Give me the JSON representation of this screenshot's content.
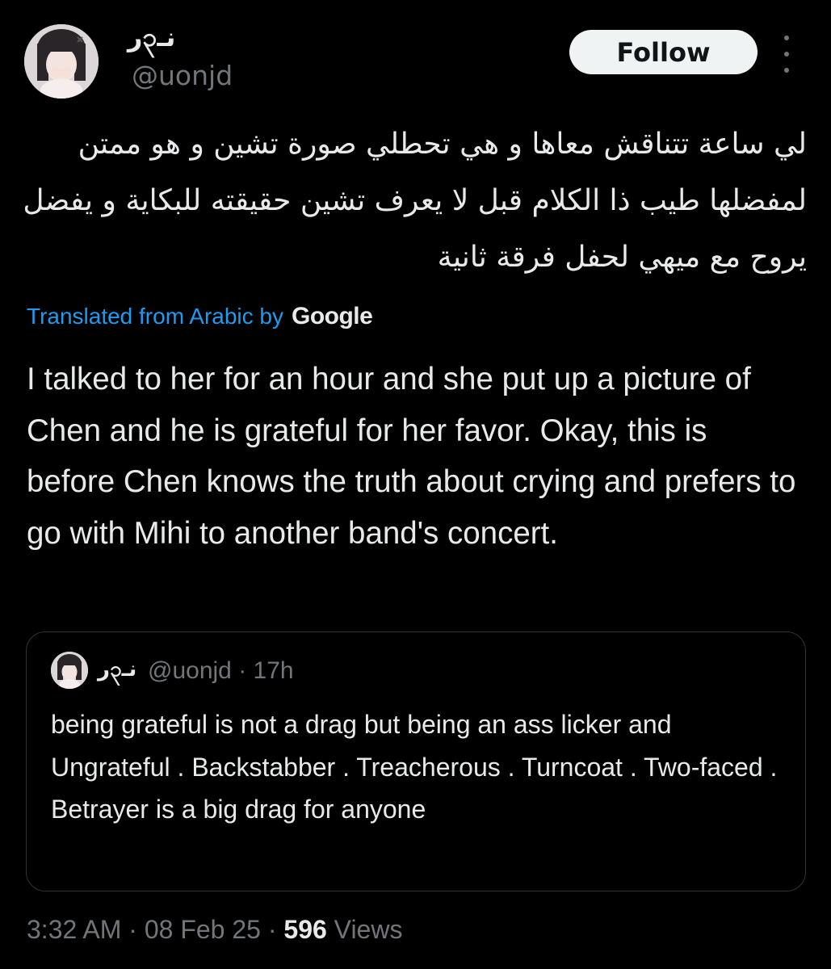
{
  "author": {
    "display_name": "نـ၃ر",
    "handle": "@uonjd"
  },
  "follow_label": "Follow",
  "tweet": {
    "arabic_text": "لي ساعة تتناقش معاها و هي تحطلي صورة تشين و هو ممتن لمفضلها طيب ذا الكلام قبل لا يعرف تشين حقيقته للبكاية و يفضل يروح مع ميهي لحفل فرقة ثانية",
    "translated_label": "Translated from Arabic by",
    "translator": "Google",
    "translated_text": "I talked to her for an hour and she put up a picture of Chen and he is grateful for her favor. Okay, this is before Chen knows the truth about crying and prefers to go with Mihi to another band's concert."
  },
  "quote": {
    "display_name": "نـ၃ر",
    "handle": "@uonjd",
    "separator": "·",
    "time_ago": "17h",
    "text": "being grateful is not a drag but being an ass licker and Ungrateful . Backstabber . Treacherous . Turncoat . Two-faced . Betrayer is a big drag for anyone"
  },
  "footer": {
    "time": "3:32 AM",
    "separator": "·",
    "date": "08 Feb 25",
    "views_count": "596",
    "views_label": "Views"
  },
  "colors": {
    "background": "#000000",
    "text_primary": "#e7e9ea",
    "text_secondary": "#71767b",
    "accent": "#1d9bf0",
    "border": "#2f3336",
    "follow_button_bg": "#eff3f4"
  },
  "icons": {
    "more": "more-vertical-icon"
  }
}
